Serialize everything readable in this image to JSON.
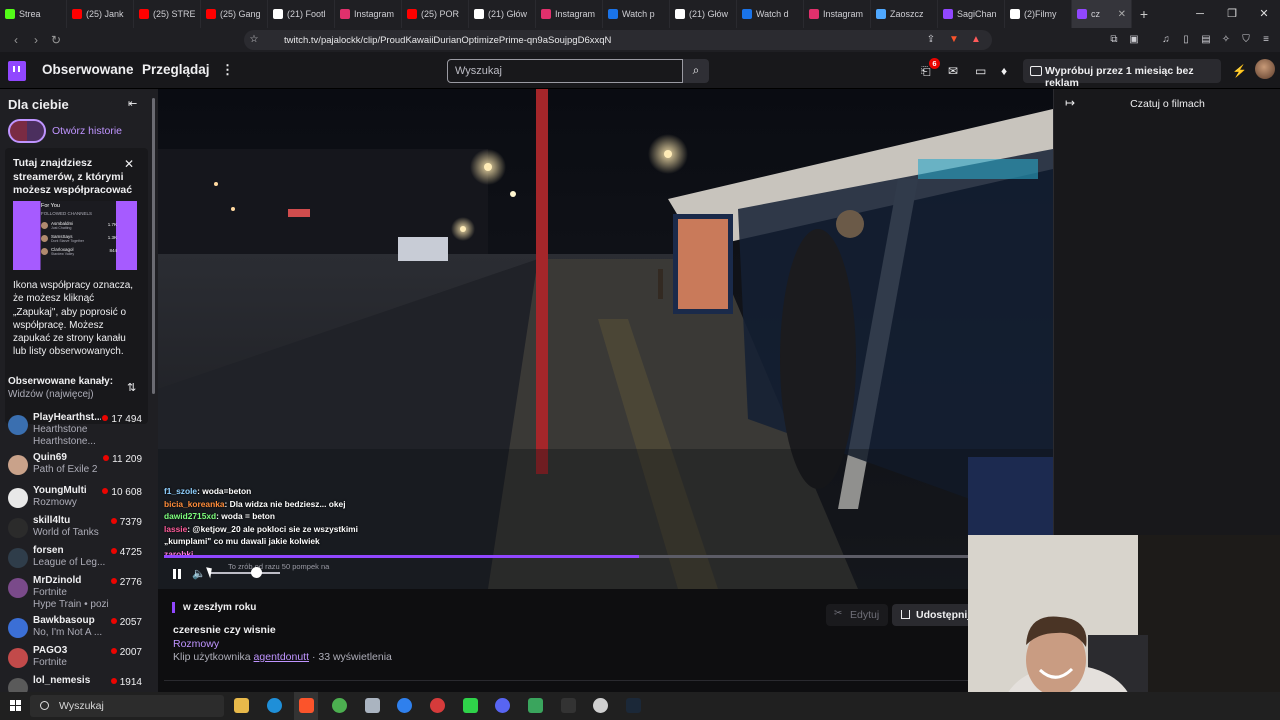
{
  "browser": {
    "tabs": [
      {
        "label": "Strea",
        "fav_color": "#53fc18"
      },
      {
        "label": "(25) Jank",
        "fav_color": "#ff0000"
      },
      {
        "label": "(25) STRE",
        "fav_color": "#ff0000"
      },
      {
        "label": "(25) Gang",
        "fav_color": "#ff0000"
      },
      {
        "label": "(21) Footl",
        "fav_color": "#ffffff"
      },
      {
        "label": "Instagram",
        "fav_color": "#e1306c"
      },
      {
        "label": "(25) POR",
        "fav_color": "#ff0000"
      },
      {
        "label": "(21) Głów",
        "fav_color": "#ffffff"
      },
      {
        "label": "Instagram",
        "fav_color": "#e1306c"
      },
      {
        "label": "Watch p",
        "fav_color": "#1a73e8"
      },
      {
        "label": "(21) Głów",
        "fav_color": "#ffffff"
      },
      {
        "label": "Watch d",
        "fav_color": "#1a73e8"
      },
      {
        "label": "Instagram",
        "fav_color": "#e1306c"
      },
      {
        "label": "Zaoszcz",
        "fav_color": "#4fa8ff"
      },
      {
        "label": "SagiChan",
        "fav_color": "#9147ff"
      },
      {
        "label": "(2)Filmy",
        "fav_color": "#ffffff"
      },
      {
        "label": "cz",
        "fav_color": "#9147ff",
        "active": true
      }
    ],
    "new_tab": "+",
    "url": "twitch.tv/pajalockk/clip/ProudKawaiiDurianOptimizePrime-qn9aSoujpgD6xxqN"
  },
  "topnav": {
    "following": "Obserwowane",
    "browse": "Przeglądaj",
    "more": "⋮",
    "search_placeholder": "Wyszukaj",
    "notif_count": "6",
    "prime_cta": "Wypróbuj przez 1 miesiąc bez reklam"
  },
  "sidebar": {
    "title": "Dla ciebie",
    "story": "Otwórz historie",
    "promo_title": "Tutaj znajdziesz streamerów, z którymi możesz współpracować",
    "promo_img_head": "For You",
    "promo_img_sub": "FOLLOWED CHANNELS",
    "promo_img_rows": [
      {
        "name": "Asmbaldmi",
        "game": "Just Chatting",
        "viewers": "1.7K"
      },
      {
        "name": "SamsSays",
        "game": "Dont Starve Together",
        "viewers": "1.3K"
      },
      {
        "name": "Clarloxagol",
        "game": "Stardew Valley",
        "viewers": "844"
      }
    ],
    "promo_body": "Ikona współpracy oznacza, że możesz kliknąć „Zapukaj\", aby poprosić o współpracę. Możesz zapukać ze strony kanału lub listy obserwowanych.",
    "followed_title": "Obserwowane kanały:",
    "followed_sort": "Widzów (najwięcej)",
    "channels": [
      {
        "name": "PlayHearthst...",
        "game": "Hearthstone",
        "game2": "Hearthstone...",
        "viewers": "17 494",
        "color": "#3a6fb0"
      },
      {
        "name": "Quin69",
        "game": "Path of Exile 2",
        "viewers": "11 209",
        "color": "#c9a28a"
      },
      {
        "name": "YoungMulti",
        "game": "Rozmowy",
        "viewers": "10 608",
        "color": "#e8e8e8"
      },
      {
        "name": "skill4ltu",
        "game": "World of Tanks",
        "viewers": "7379",
        "color": "#2b2b2b"
      },
      {
        "name": "forsen",
        "game": "League of Leg...",
        "viewers": "4725",
        "color": "#2f3d4a"
      },
      {
        "name": "MrDzinold",
        "game": "Fortnite",
        "game2": "Hype Train • pozio...",
        "viewers": "2776",
        "color": "#7a4a8a"
      },
      {
        "name": "Bawkbasoup",
        "game": "No, I'm Not A ...",
        "viewers": "2057",
        "color": "#3b6fd6"
      },
      {
        "name": "PAGO3",
        "game": "Fortnite",
        "viewers": "2007",
        "color": "#c24a4a"
      },
      {
        "name": "lol_nemesis",
        "game": "",
        "viewers": "1914",
        "color": "#5a5a5a"
      }
    ]
  },
  "video": {
    "overlay_chat": [
      {
        "user": "f1_szole",
        "color": "#8fd0ff",
        "text": "woda=beton"
      },
      {
        "user": "bicia_koreanka",
        "color": "#ff8c3a",
        "text": "Dla widza nie bedziesz... okej"
      },
      {
        "user": "dawid2715xd",
        "color": "#7dff7d",
        "text": "woda = beton"
      },
      {
        "user": "lassie",
        "color": "#ff5a9a",
        "text": "@ketjow_20 ale pokloci sie ze wszystkimi „kumplami\" co mu dawali jakie kolwiek"
      },
      {
        "user": "",
        "color": "#ff7ad9",
        "text": "zarobki"
      }
    ],
    "ticker": "To zrób od razu 50 pompek na",
    "progress_fraction": 0.59,
    "volume_fraction": 0.66
  },
  "chat_panel": {
    "title": "Czatuj o filmach"
  },
  "clip": {
    "date": "w zeszłym roku",
    "title": "czeresnie czy wisnie",
    "category": "Rozmowy",
    "by_prefix": "Klip użytkownika",
    "author": "agentdonutt",
    "views": "· 33 wyświetlenia",
    "edit": "Edytuj",
    "share": "Udostępnij"
  },
  "taskbar": {
    "search": "Wyszukaj"
  }
}
